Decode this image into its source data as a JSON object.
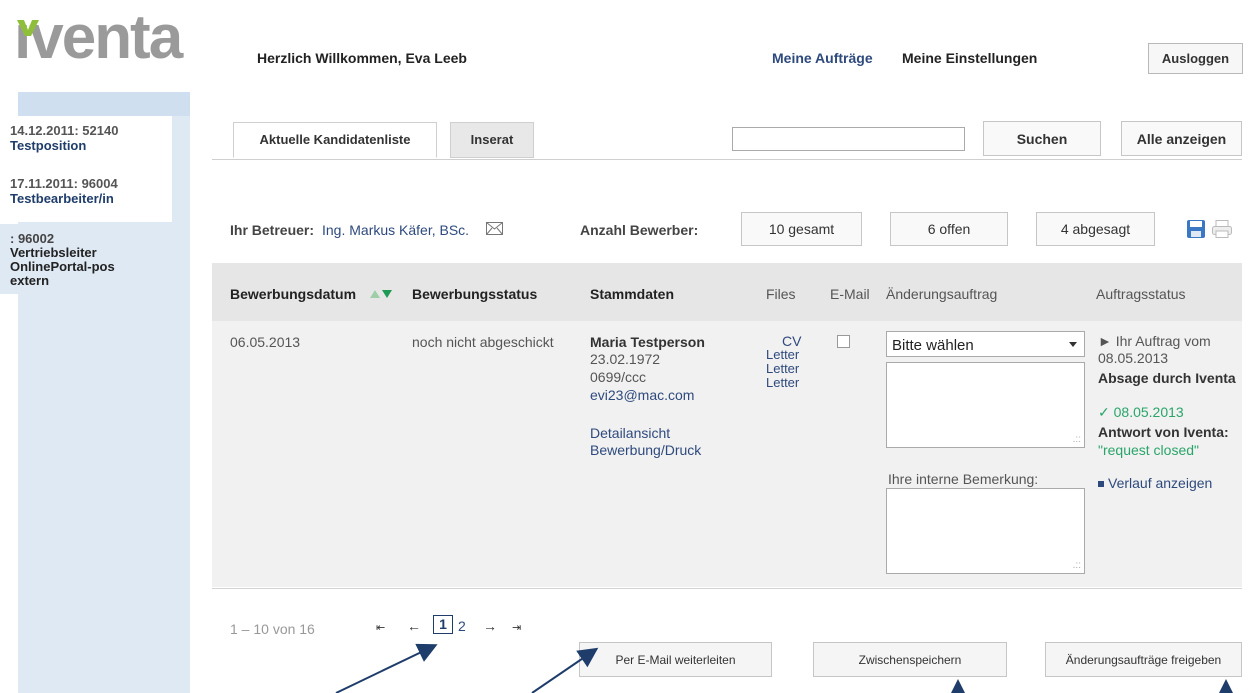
{
  "header": {
    "logo_text": "iventa",
    "welcome": "Herzlich Willkommen, Eva Leeb",
    "nav_my_orders": "Meine Aufträge",
    "nav_my_settings": "Meine Einstellungen",
    "logout": "Ausloggen"
  },
  "sidebar": {
    "items": [
      {
        "date": "14.12.2011: 52140",
        "name": "Testposition",
        "active": false
      },
      {
        "date": "17.11.2011: 96004",
        "name": "Testbearbeiter/in",
        "active": false
      },
      {
        "date": ": 96002",
        "name": "Vertriebsleiter OnlinePortal-pos extern",
        "active": true
      }
    ]
  },
  "tabs": [
    {
      "label": "Aktuelle Kandidatenliste",
      "active": true
    },
    {
      "label": "Inserat",
      "active": false
    }
  ],
  "search": {
    "value": "",
    "button": "Suchen",
    "show_all": "Alle anzeigen"
  },
  "info": {
    "betreuer_label": "Ihr Betreuer:",
    "betreuer_name": "Ing. Markus Käfer, BSc.",
    "anzahl_label": "Anzahl Bewerber:",
    "total": "10 gesamt",
    "open": "6 offen",
    "rejected": "4 abgesagt"
  },
  "table": {
    "headers": {
      "date": "Bewerbungsdatum",
      "status": "Bewerbungsstatus",
      "master": "Stammdaten",
      "files": "Files",
      "email": "E-Mail",
      "change": "Änderungsauftrag",
      "order_status": "Auftragsstatus"
    },
    "row": {
      "date": "06.05.2013",
      "status": "noch nicht abgeschickt",
      "name": "Maria Testperson",
      "birth": "23.02.1972",
      "phone": "0699/ccc",
      "email": "evi23@mac.com",
      "detail": "Detailansicht",
      "print": "Bewerbung/Druck",
      "files": [
        "CV",
        "Letter",
        "Letter",
        "Letter"
      ],
      "select_value": "Bitte wählen",
      "internal_note_label": "Ihre interne Bemerkung:",
      "order_line1": "► Ihr Auftrag vom",
      "order_line2": "08.05.2013",
      "order_line3": "Absage durch Iventa",
      "answer_line1": "✓ 08.05.2013",
      "answer_line2": "Antwort von Iventa:",
      "answer_line3": "\"request closed\"",
      "history": "Verlauf anzeigen"
    }
  },
  "footer": {
    "range": "1 – 10 von 16",
    "pager_first": "⇤",
    "pager_prev": "←",
    "page1": "1",
    "page2": "2",
    "pager_next": "→",
    "pager_last": "⇥",
    "forward": "Per E-Mail weiterleiten",
    "save": "Zwischenspeichern",
    "release": "Änderungsaufträge freigeben"
  },
  "colors": {
    "brand_blue": "#2e4a7d",
    "logo_gray": "#9a9a9a",
    "logo_green": "#8fbf3a",
    "status_green": "#2aa56a",
    "sidebar_bg": "#dfe9f4"
  }
}
